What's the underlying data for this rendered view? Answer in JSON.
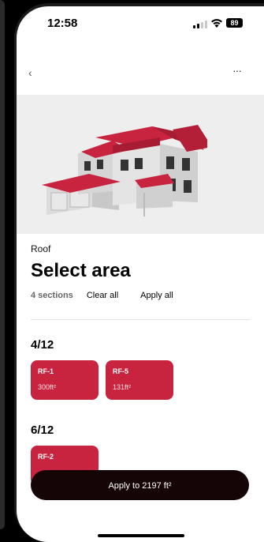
{
  "status_bar": {
    "time": "12:58",
    "battery": "89"
  },
  "nav": {
    "back_icon": "‹",
    "more_icon": "···"
  },
  "header": {
    "category": "Roof",
    "title": "Select area"
  },
  "filters": {
    "count": "4 sections",
    "clear_label": "Clear all",
    "apply_label": "Apply all"
  },
  "groups": [
    {
      "pitch": "4/12",
      "sections": [
        {
          "name": "RF-1",
          "area": "300ft²"
        },
        {
          "name": "RF-5",
          "area": "131ft²"
        }
      ]
    },
    {
      "pitch": "6/12",
      "sections": [
        {
          "name": "RF-2",
          "area": ""
        }
      ]
    }
  ],
  "cta": {
    "label": "Apply to 2197 ft²"
  },
  "colors": {
    "accent": "#c9243f",
    "cta_bg": "#150507",
    "hero_bg": "#eeeeee"
  }
}
